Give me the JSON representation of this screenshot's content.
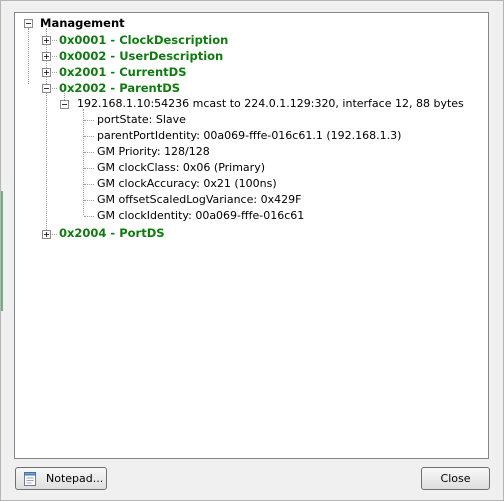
{
  "tree": {
    "root": "Management",
    "items": [
      {
        "label": "0x0001 - ClockDescription",
        "expanded": false
      },
      {
        "label": "0x0002 - UserDescription",
        "expanded": false
      },
      {
        "label": "0x2001 - CurrentDS",
        "expanded": false
      },
      {
        "label": "0x2002 - ParentDS",
        "expanded": true
      },
      {
        "label": "0x2004 - PortDS",
        "expanded": false
      }
    ],
    "packet": "192.168.1.10:54236 mcast to 224.0.1.129:320, interface 12, 88 bytes",
    "fields": [
      "portState: Slave",
      "parentPortIdentity: 00a069-fffe-016c61.1 (192.168.1.3)",
      "GM Priority: 128/128",
      "GM clockClass: 0x06 (Primary)",
      "GM clockAccuracy: 0x21 (100ns)",
      "GM offsetScaledLogVariance: 0x429F",
      "GM clockIdentity: 00a069-fffe-016c61"
    ]
  },
  "buttons": {
    "notepad": "Notepad...",
    "close": "Close"
  },
  "colors": {
    "group_label": "#117a11"
  }
}
